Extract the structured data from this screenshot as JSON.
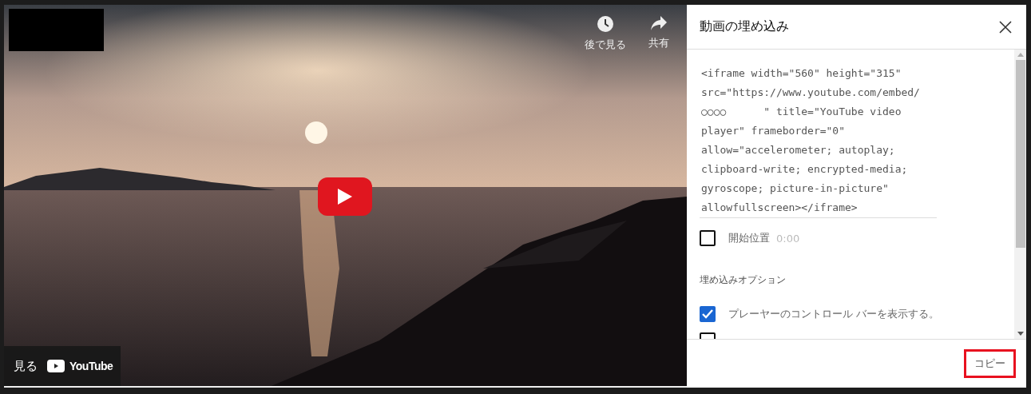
{
  "video": {
    "actions": [
      {
        "kind": "clock",
        "label": "後で見る"
      },
      {
        "kind": "share",
        "label": "共有"
      }
    ],
    "watch_on": {
      "label": "見る",
      "logo": "YouTube"
    }
  },
  "embed_dialog": {
    "title": "動画の埋め込み",
    "code_lines": [
      "<iframe width=\"560\" height=\"315\"",
      "src=\"https://www.youtube.com/embed/",
      "○○○○      \" title=\"YouTube video",
      "player\" frameborder=\"0\"",
      "allow=\"accelerometer; autoplay;",
      "clipboard-write; encrypted-media;",
      "gyroscope; picture-in-picture\"",
      "allowfullscreen></iframe>"
    ],
    "start_at": {
      "label": "開始位置",
      "checked": false,
      "time": "0:00"
    },
    "options_heading": "埋め込みオプション",
    "options": [
      {
        "label": "プレーヤーのコントロール バーを表示する。",
        "checked": true
      },
      {
        "checked": false
      }
    ],
    "copy_button": "コピー"
  }
}
